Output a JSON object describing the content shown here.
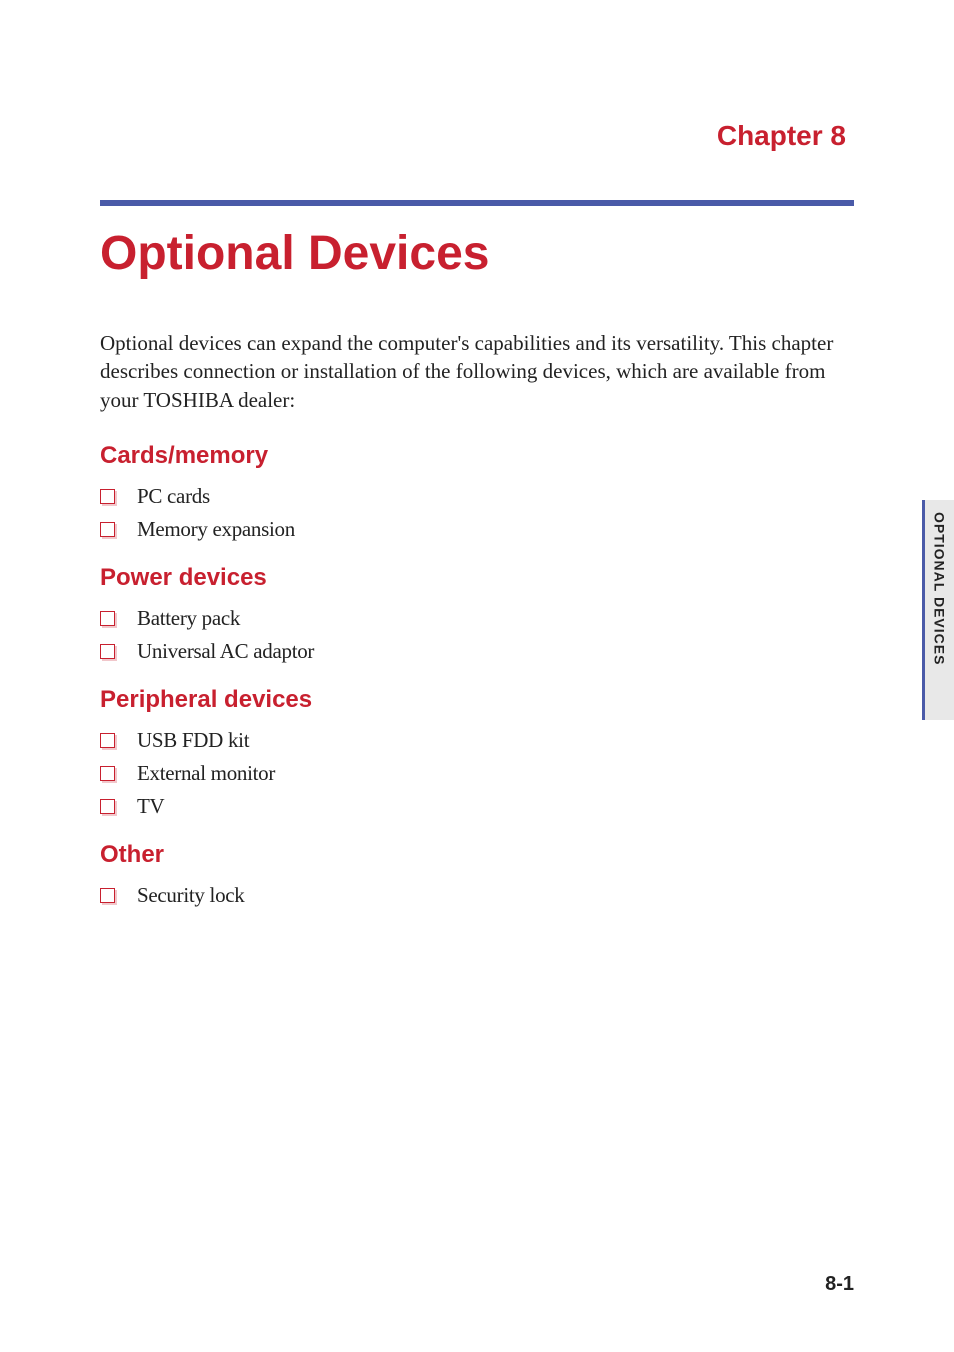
{
  "chapter_label": "Chapter  8",
  "title": "Optional Devices",
  "intro": "Optional devices can expand the computer's capabilities and its versatility. This chapter describes connection or installation of the following devices, which are available from your TOSHIBA dealer:",
  "sections": [
    {
      "heading": "Cards/memory",
      "items": [
        "PC cards",
        "Memory expansion"
      ]
    },
    {
      "heading": "Power devices",
      "items": [
        "Battery pack",
        "Universal AC adaptor"
      ]
    },
    {
      "heading": "Peripheral devices",
      "items": [
        "USB FDD kit",
        "External monitor",
        "TV"
      ]
    },
    {
      "heading": "Other",
      "items": [
        "Security lock"
      ]
    }
  ],
  "side_tab": "OPTIONAL DEVICES",
  "page_number": "8-1"
}
